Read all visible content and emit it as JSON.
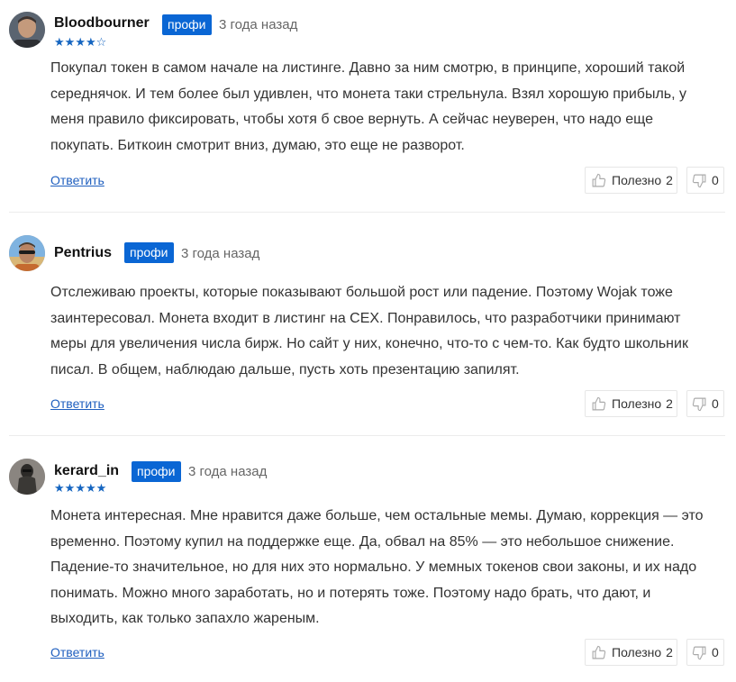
{
  "reviews": [
    {
      "author": "Bloodbourner",
      "badge": "профи",
      "time": "3 года назад",
      "rating": 4,
      "stars": [
        "★",
        "★",
        "★",
        "★",
        "☆"
      ],
      "text": "Покупал токен в самом начале на листинге. Давно за ним смотрю, в принципе, хороший такой середнячок. И тем более был удивлен, что монета таки стрельнула. Взял хорошую прибыль, у меня правило фиксировать, чтобы хотя б свое вернуть. А сейчас неуверен, что надо еще покупать. Биткоин смотрит вниз, думаю, это еще не разворот.",
      "reply": "Ответить",
      "useful_label": "Полезно",
      "useful_count": "2",
      "dislike_count": "0"
    },
    {
      "author": "Pentrius",
      "badge": "профи",
      "time": "3 года назад",
      "rating": null,
      "stars": [],
      "text": "Отслеживаю проекты, которые показывают большой рост или падение. Поэтому Wojak тоже заинтересовал. Монета входит в листинг на CEX. Понравилось, что разработчики принимают меры для увеличения числа бирж. Но сайт у них, конечно, что-то с чем-то. Как будто школьник писал. В общем, наблюдаю дальше, пусть хоть презентацию запилят.",
      "reply": "Ответить",
      "useful_label": "Полезно",
      "useful_count": "2",
      "dislike_count": "0"
    },
    {
      "author": "kerard_in",
      "badge": "профи",
      "time": "3 года назад",
      "rating": 5,
      "stars": [
        "★",
        "★",
        "★",
        "★",
        "★"
      ],
      "text": "Монета интересная. Мне нравится даже больше, чем остальные мемы. Думаю, коррекция — это временно. Поэтому купил на поддержке еще. Да, обвал на 85% — это небольшое снижение. Падение-то значительное, но для них это нормально. У мемных токенов свои законы, и их надо понимать. Можно много заработать, но и потерять тоже. Поэтому надо брать, что дают, и выходить, как только запахло жареным.",
      "reply": "Ответить",
      "useful_label": "Полезно",
      "useful_count": "2",
      "dislike_count": "0"
    }
  ],
  "colors": {
    "badge": "#0a66d4",
    "star": "#1565c0",
    "link": "#1f5fbf"
  }
}
